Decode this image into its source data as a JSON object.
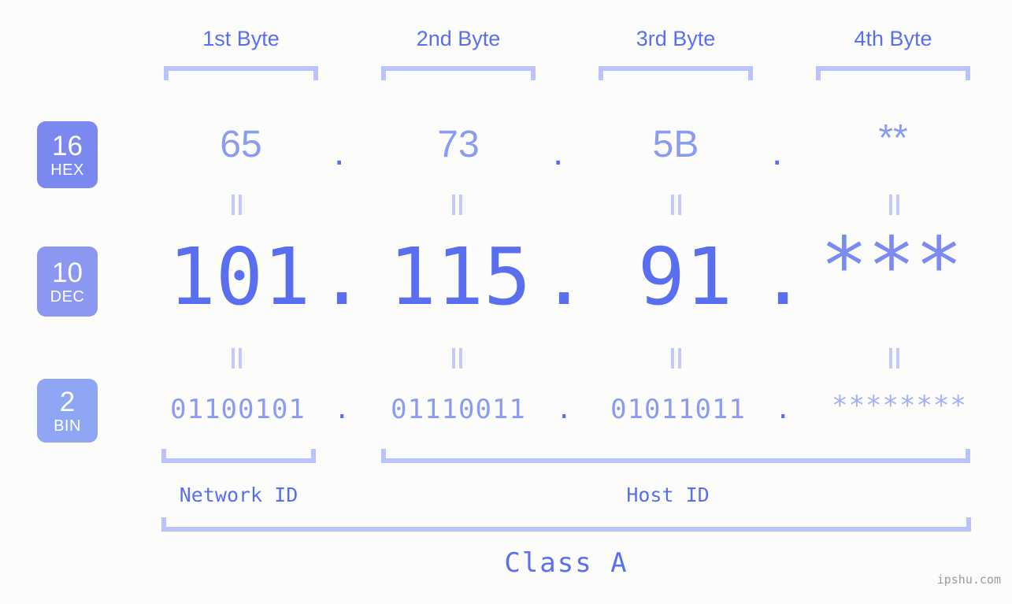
{
  "background": "#fcfdfa",
  "accent": "#5a6ef0",
  "accent_light": "#8b9bf2",
  "bracket_color": "#b9c2fb",
  "byte_headers": [
    {
      "label": "1st Byte"
    },
    {
      "label": "2nd Byte"
    },
    {
      "label": "3rd Byte"
    },
    {
      "label": "4th Byte"
    }
  ],
  "bases": [
    {
      "number": "16",
      "name": "HEX",
      "color": "#7b88ef"
    },
    {
      "number": "10",
      "name": "DEC",
      "color": "#8b97f0"
    },
    {
      "number": "2",
      "name": "BIN",
      "color": "#8fa6f5"
    }
  ],
  "rows": {
    "hex": {
      "base_number": "16",
      "base_name": "HEX",
      "values": [
        "65",
        "73",
        "5B",
        "**"
      ],
      "separator": "."
    },
    "dec": {
      "base_number": "10",
      "base_name": "DEC",
      "values": [
        "101",
        "115",
        "91",
        "***"
      ],
      "separator": "."
    },
    "bin": {
      "base_number": "2",
      "base_name": "BIN",
      "values": [
        "01100101",
        "01110011",
        "01011011",
        "********"
      ],
      "separator": "."
    }
  },
  "equality_symbol": "=",
  "segments": {
    "network_id": "Network ID",
    "host_id": "Host ID",
    "class": "Class A"
  },
  "watermark": "ipshu.com"
}
